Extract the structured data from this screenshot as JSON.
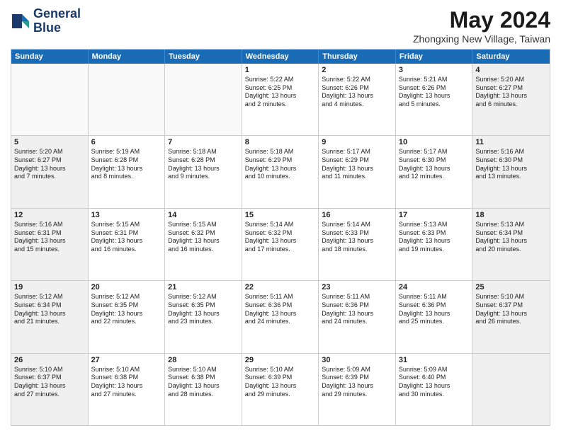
{
  "logo": {
    "line1": "General",
    "line2": "Blue"
  },
  "title": "May 2024",
  "subtitle": "Zhongxing New Village, Taiwan",
  "header_days": [
    "Sunday",
    "Monday",
    "Tuesday",
    "Wednesday",
    "Thursday",
    "Friday",
    "Saturday"
  ],
  "rows": [
    [
      {
        "day": "",
        "lines": [],
        "shaded": false
      },
      {
        "day": "",
        "lines": [],
        "shaded": false
      },
      {
        "day": "",
        "lines": [],
        "shaded": false
      },
      {
        "day": "1",
        "lines": [
          "Sunrise: 5:22 AM",
          "Sunset: 6:25 PM",
          "Daylight: 13 hours",
          "and 2 minutes."
        ],
        "shaded": false
      },
      {
        "day": "2",
        "lines": [
          "Sunrise: 5:22 AM",
          "Sunset: 6:26 PM",
          "Daylight: 13 hours",
          "and 4 minutes."
        ],
        "shaded": false
      },
      {
        "day": "3",
        "lines": [
          "Sunrise: 5:21 AM",
          "Sunset: 6:26 PM",
          "Daylight: 13 hours",
          "and 5 minutes."
        ],
        "shaded": false
      },
      {
        "day": "4",
        "lines": [
          "Sunrise: 5:20 AM",
          "Sunset: 6:27 PM",
          "Daylight: 13 hours",
          "and 6 minutes."
        ],
        "shaded": true
      }
    ],
    [
      {
        "day": "5",
        "lines": [
          "Sunrise: 5:20 AM",
          "Sunset: 6:27 PM",
          "Daylight: 13 hours",
          "and 7 minutes."
        ],
        "shaded": true
      },
      {
        "day": "6",
        "lines": [
          "Sunrise: 5:19 AM",
          "Sunset: 6:28 PM",
          "Daylight: 13 hours",
          "and 8 minutes."
        ],
        "shaded": false
      },
      {
        "day": "7",
        "lines": [
          "Sunrise: 5:18 AM",
          "Sunset: 6:28 PM",
          "Daylight: 13 hours",
          "and 9 minutes."
        ],
        "shaded": false
      },
      {
        "day": "8",
        "lines": [
          "Sunrise: 5:18 AM",
          "Sunset: 6:29 PM",
          "Daylight: 13 hours",
          "and 10 minutes."
        ],
        "shaded": false
      },
      {
        "day": "9",
        "lines": [
          "Sunrise: 5:17 AM",
          "Sunset: 6:29 PM",
          "Daylight: 13 hours",
          "and 11 minutes."
        ],
        "shaded": false
      },
      {
        "day": "10",
        "lines": [
          "Sunrise: 5:17 AM",
          "Sunset: 6:30 PM",
          "Daylight: 13 hours",
          "and 12 minutes."
        ],
        "shaded": false
      },
      {
        "day": "11",
        "lines": [
          "Sunrise: 5:16 AM",
          "Sunset: 6:30 PM",
          "Daylight: 13 hours",
          "and 13 minutes."
        ],
        "shaded": true
      }
    ],
    [
      {
        "day": "12",
        "lines": [
          "Sunrise: 5:16 AM",
          "Sunset: 6:31 PM",
          "Daylight: 13 hours",
          "and 15 minutes."
        ],
        "shaded": true
      },
      {
        "day": "13",
        "lines": [
          "Sunrise: 5:15 AM",
          "Sunset: 6:31 PM",
          "Daylight: 13 hours",
          "and 16 minutes."
        ],
        "shaded": false
      },
      {
        "day": "14",
        "lines": [
          "Sunrise: 5:15 AM",
          "Sunset: 6:32 PM",
          "Daylight: 13 hours",
          "and 16 minutes."
        ],
        "shaded": false
      },
      {
        "day": "15",
        "lines": [
          "Sunrise: 5:14 AM",
          "Sunset: 6:32 PM",
          "Daylight: 13 hours",
          "and 17 minutes."
        ],
        "shaded": false
      },
      {
        "day": "16",
        "lines": [
          "Sunrise: 5:14 AM",
          "Sunset: 6:33 PM",
          "Daylight: 13 hours",
          "and 18 minutes."
        ],
        "shaded": false
      },
      {
        "day": "17",
        "lines": [
          "Sunrise: 5:13 AM",
          "Sunset: 6:33 PM",
          "Daylight: 13 hours",
          "and 19 minutes."
        ],
        "shaded": false
      },
      {
        "day": "18",
        "lines": [
          "Sunrise: 5:13 AM",
          "Sunset: 6:34 PM",
          "Daylight: 13 hours",
          "and 20 minutes."
        ],
        "shaded": true
      }
    ],
    [
      {
        "day": "19",
        "lines": [
          "Sunrise: 5:12 AM",
          "Sunset: 6:34 PM",
          "Daylight: 13 hours",
          "and 21 minutes."
        ],
        "shaded": true
      },
      {
        "day": "20",
        "lines": [
          "Sunrise: 5:12 AM",
          "Sunset: 6:35 PM",
          "Daylight: 13 hours",
          "and 22 minutes."
        ],
        "shaded": false
      },
      {
        "day": "21",
        "lines": [
          "Sunrise: 5:12 AM",
          "Sunset: 6:35 PM",
          "Daylight: 13 hours",
          "and 23 minutes."
        ],
        "shaded": false
      },
      {
        "day": "22",
        "lines": [
          "Sunrise: 5:11 AM",
          "Sunset: 6:36 PM",
          "Daylight: 13 hours",
          "and 24 minutes."
        ],
        "shaded": false
      },
      {
        "day": "23",
        "lines": [
          "Sunrise: 5:11 AM",
          "Sunset: 6:36 PM",
          "Daylight: 13 hours",
          "and 24 minutes."
        ],
        "shaded": false
      },
      {
        "day": "24",
        "lines": [
          "Sunrise: 5:11 AM",
          "Sunset: 6:36 PM",
          "Daylight: 13 hours",
          "and 25 minutes."
        ],
        "shaded": false
      },
      {
        "day": "25",
        "lines": [
          "Sunrise: 5:10 AM",
          "Sunset: 6:37 PM",
          "Daylight: 13 hours",
          "and 26 minutes."
        ],
        "shaded": true
      }
    ],
    [
      {
        "day": "26",
        "lines": [
          "Sunrise: 5:10 AM",
          "Sunset: 6:37 PM",
          "Daylight: 13 hours",
          "and 27 minutes."
        ],
        "shaded": true
      },
      {
        "day": "27",
        "lines": [
          "Sunrise: 5:10 AM",
          "Sunset: 6:38 PM",
          "Daylight: 13 hours",
          "and 27 minutes."
        ],
        "shaded": false
      },
      {
        "day": "28",
        "lines": [
          "Sunrise: 5:10 AM",
          "Sunset: 6:38 PM",
          "Daylight: 13 hours",
          "and 28 minutes."
        ],
        "shaded": false
      },
      {
        "day": "29",
        "lines": [
          "Sunrise: 5:10 AM",
          "Sunset: 6:39 PM",
          "Daylight: 13 hours",
          "and 29 minutes."
        ],
        "shaded": false
      },
      {
        "day": "30",
        "lines": [
          "Sunrise: 5:09 AM",
          "Sunset: 6:39 PM",
          "Daylight: 13 hours",
          "and 29 minutes."
        ],
        "shaded": false
      },
      {
        "day": "31",
        "lines": [
          "Sunrise: 5:09 AM",
          "Sunset: 6:40 PM",
          "Daylight: 13 hours",
          "and 30 minutes."
        ],
        "shaded": false
      },
      {
        "day": "",
        "lines": [],
        "shaded": true
      }
    ]
  ]
}
